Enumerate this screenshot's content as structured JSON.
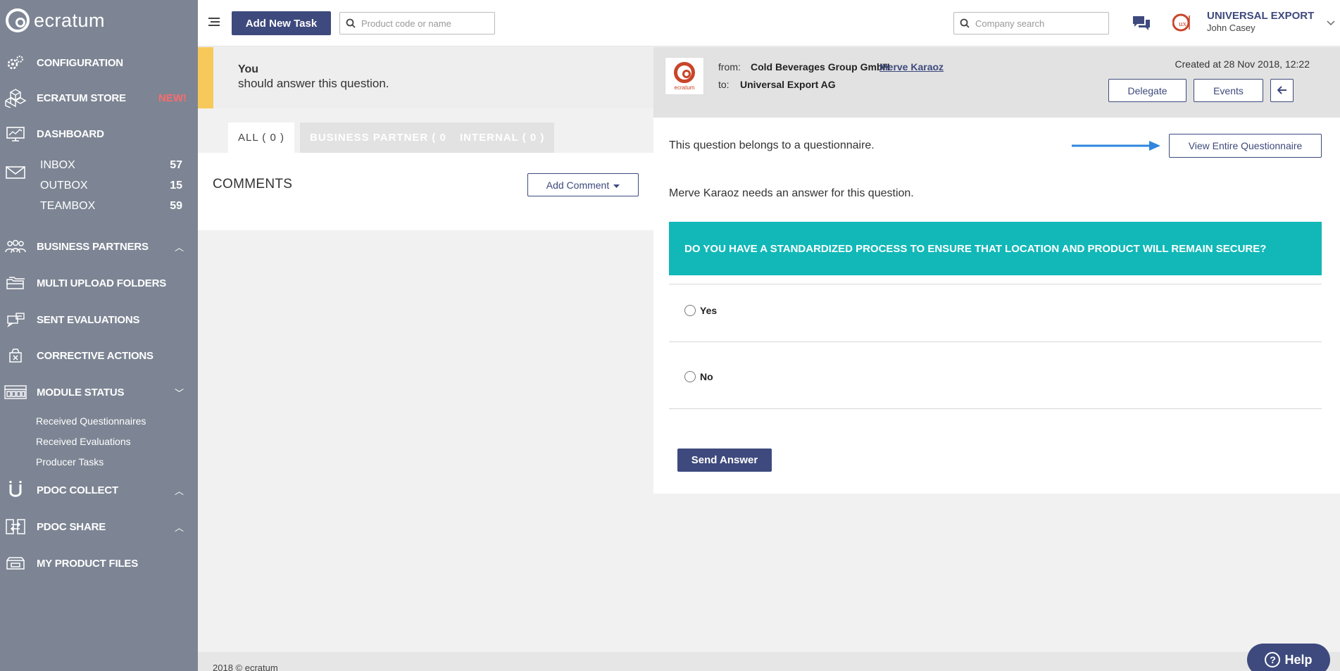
{
  "brand": {
    "name": "ecratum"
  },
  "sidebar": {
    "items": [
      {
        "label": "Configuration",
        "icon": "gears-icon"
      },
      {
        "label": "Ecratum Store",
        "icon": "cubes-icon",
        "badge": "NEW!"
      },
      {
        "label": "Dashboard",
        "icon": "monitor-chart-icon"
      },
      {
        "label": "Business Partners",
        "icon": "people-icon",
        "chevron": "︿"
      },
      {
        "label": "Multi Upload Folders",
        "icon": "folders-icon"
      },
      {
        "label": "Sent Evaluations",
        "icon": "evaluation-icon"
      },
      {
        "label": "Corrective Actions",
        "icon": "box-x-icon"
      },
      {
        "label": "Module Status",
        "icon": "modules-icon",
        "chevron": "﹀"
      },
      {
        "label": "PDoc Collect",
        "icon": "magnet-icon",
        "chevron": "︿"
      },
      {
        "label": "PDoc Share",
        "icon": "share-doc-icon",
        "chevron": "︿"
      },
      {
        "label": "My Product Files",
        "icon": "product-files-icon"
      }
    ],
    "mail": [
      {
        "label": "Inbox",
        "count": "57"
      },
      {
        "label": "Outbox",
        "count": "15"
      },
      {
        "label": "Teambox",
        "count": "59"
      }
    ],
    "module_status": [
      "Received Questionnaires",
      "Received Evaluations",
      "Producer Tasks"
    ]
  },
  "topbar": {
    "add_task_label": "Add New Task",
    "product_search_placeholder": "Product code or name",
    "company_search_placeholder": "Company search",
    "company_name": "UNIVERSAL EXPORT",
    "user_name": "John Casey"
  },
  "notice": {
    "line1": "You",
    "line2": "should answer this question."
  },
  "tabs": [
    {
      "label": "ALL ( 0 )"
    },
    {
      "label": "BUSINESS PARTNER ( 0 )"
    },
    {
      "label": "INTERNAL ( 0 )"
    }
  ],
  "comments": {
    "title": "COMMENTS",
    "add_label": "Add Comment"
  },
  "message": {
    "logo_text": "ecratum",
    "from_label": "from:",
    "from_company": "Cold Beverages Group GmbH",
    "from_person": "Merve Karaoz",
    "to_label": "to:",
    "to_company": "Universal Export AG",
    "created": "Created at 28 Nov 2018, 12:22",
    "delegate_label": "Delegate",
    "events_label": "Events"
  },
  "question": {
    "belongs_text": "This question belongs to a questionnaire.",
    "view_label": "View Entire Questionnaire",
    "needs_text": "Merve Karaoz needs an answer for this question.",
    "text": "DO YOU HAVE A STANDARDIZED PROCESS TO ENSURE THAT LOCATION AND PRODUCT WILL REMAIN SECURE?",
    "options": [
      "Yes",
      "No"
    ],
    "send_label": "Send Answer"
  },
  "footer": {
    "text": "2018 © ecratum"
  },
  "help": {
    "label": "Help"
  },
  "colors": {
    "sidebar_bg": "#7d8594",
    "primary": "#3e4a7d",
    "question_bg": "#12b8b8",
    "notice_accent": "#f7c95a",
    "new_badge": "#ff6a6a",
    "arrow": "#2e86de"
  }
}
